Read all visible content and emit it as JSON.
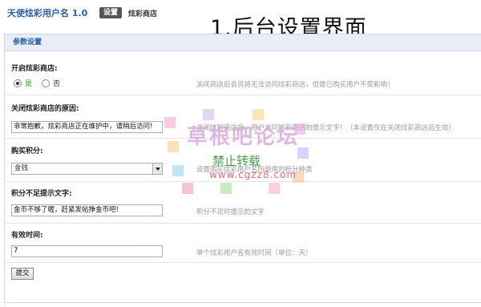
{
  "header": {
    "app_title": "天使炫彩用户名 1.0",
    "settings_tag": "设置",
    "shop_tag": "炫彩商店",
    "overlay_heading": "1.后台设置界面"
  },
  "panel": {
    "title": "参数设置"
  },
  "fields": {
    "shop_open": {
      "label": "开启炫彩商店:",
      "option_yes": "是",
      "option_no": "否",
      "selected": "是",
      "hint": "关闭商店后会员将无法访问炫彩商店，但是已购买用户不受影响！"
    },
    "close_reason": {
      "label": "关闭炫彩商店的原因:",
      "value": "非常抱歉，炫彩商店正在维护中，请稍后访问!",
      "hint": "关闭炫彩商店后，用户访问炫彩商店的提示文字！（本设置仅在关闭炫彩商店后生效）"
    },
    "purchase_points": {
      "label": "购买积分:",
      "value": "金钱",
      "hint": "设置购买炫彩用户名所使用的积分种类"
    },
    "insufficient_points": {
      "label": "积分不足提示文字:",
      "value": "金币不够了喔，赶紧发帖挣金币吧!",
      "hint": "积分不足时提示的文字"
    },
    "valid_time": {
      "label": "有效时间:",
      "value": "7",
      "hint": "单个炫彩用户名有效时间（单位：天）"
    }
  },
  "submit_label": "提交",
  "watermark": {
    "title": "草根吧论坛",
    "subtitle": "禁止转载",
    "url": "www.cgzz8.com"
  },
  "colors": {
    "accent": "#2b5ea8",
    "panel_header_bg": "#e7eef8",
    "yes_green": "#2aa32a",
    "hint_gray": "#999999"
  }
}
